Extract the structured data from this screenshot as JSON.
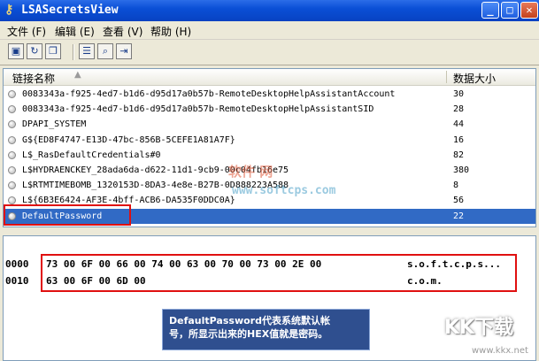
{
  "window": {
    "title": "LSASecretsView",
    "icon": "key-icon",
    "min_label": "_",
    "max_label": "□",
    "close_label": "✕"
  },
  "menu": [
    {
      "label": "文件 (F)"
    },
    {
      "label": "编辑 (E)"
    },
    {
      "label": "查看 (V)"
    },
    {
      "label": "帮助 (H)"
    }
  ],
  "toolbar": {
    "buttons": [
      "save-icon",
      "refresh-icon",
      "copy-icon",
      "properties-icon",
      "find-icon",
      "exit-icon"
    ]
  },
  "list": {
    "columns": {
      "name": "链接名称",
      "size": "数据大小"
    },
    "rows": [
      {
        "name": "0083343a-f925-4ed7-b1d6-d95d17a0b57b-RemoteDesktopHelpAssistantAccount",
        "size": "30"
      },
      {
        "name": "0083343a-f925-4ed7-b1d6-d95d17a0b57b-RemoteDesktopHelpAssistantSID",
        "size": "28"
      },
      {
        "name": "DPAPI_SYSTEM",
        "size": "44"
      },
      {
        "name": "G${ED8F4747-E13D-47bc-856B-5CEFE1A81A7F}",
        "size": "16"
      },
      {
        "name": "L$_RasDefaultCredentials#0",
        "size": "82"
      },
      {
        "name": "L$HYDRAENCKEY_28ada6da-d622-11d1-9cb9-00c04fb16e75",
        "size": "380"
      },
      {
        "name": "L$RTMTIMEBOMB_1320153D-8DA3-4e8e-B27B-0D888223A588",
        "size": "8"
      },
      {
        "name": "L${6B3E6424-AF3E-4bff-ACB6-DA535F0DDC0A}",
        "size": "56"
      },
      {
        "name": "DefaultPassword",
        "size": "22"
      }
    ],
    "selected_index": 8
  },
  "hex": {
    "lines": [
      {
        "offset": "0000",
        "bytes": "73 00 6F 00 66 00 74 00 63 00 70 00 73 00 2E 00",
        "ascii": "s.o.f.t.c.p.s..."
      },
      {
        "offset": "0010",
        "bytes": "63 00 6F 00 6D 00",
        "ascii": "c.o.m."
      }
    ]
  },
  "annotation": {
    "line1": "DefaultPassword代表系统默认帐",
    "line2": "号，所显示出来的HEX值就是密码。"
  },
  "watermarks": {
    "center_cn": "软件 网",
    "center_url": "www.softcps.com",
    "logo": "KK下载",
    "logo_url": "www.kkx.net"
  },
  "colors": {
    "selection": "#316ac5",
    "highlight_box": "#e01010",
    "title_bar": "#0a4fd6"
  }
}
